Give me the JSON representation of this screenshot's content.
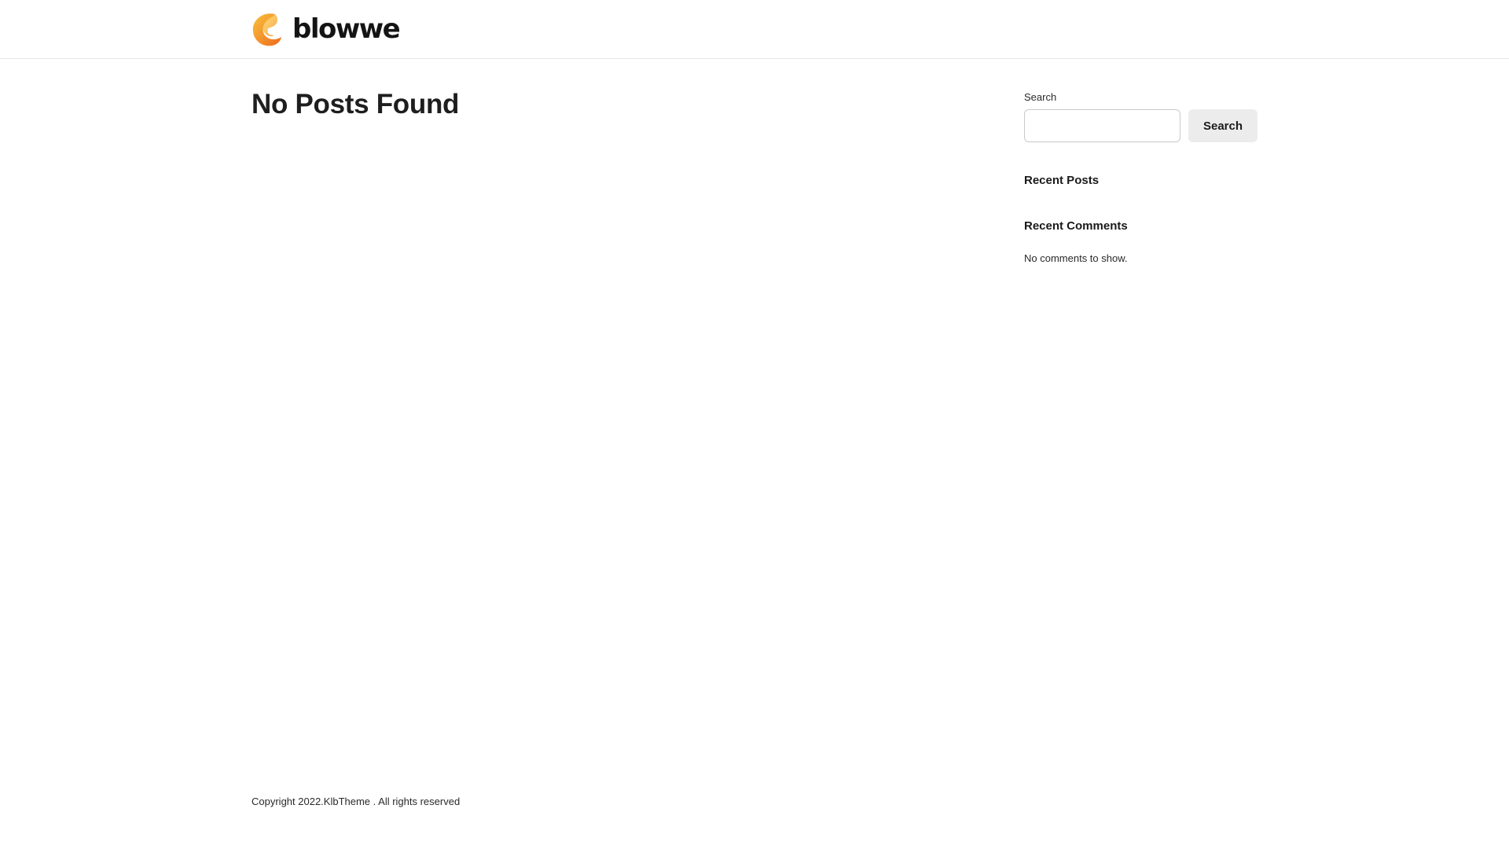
{
  "header": {
    "logo_text": "blowwe",
    "logo_icon": "blowwe-logo-icon"
  },
  "main": {
    "title": "No Posts Found"
  },
  "sidebar": {
    "search_label": "Search",
    "search_value": "",
    "search_placeholder": "",
    "search_button_label": "Search",
    "recent_posts_title": "Recent Posts",
    "recent_comments_title": "Recent Comments",
    "no_comments_text": "No comments to show."
  },
  "footer": {
    "copyright": "Copyright 2022.KlbTheme . All rights reserved"
  },
  "colors": {
    "logo_gradient_start": "#F9B21D",
    "logo_gradient_end": "#F0731E",
    "button_background": "#ECECEC",
    "divider": "#E6E6E6"
  }
}
